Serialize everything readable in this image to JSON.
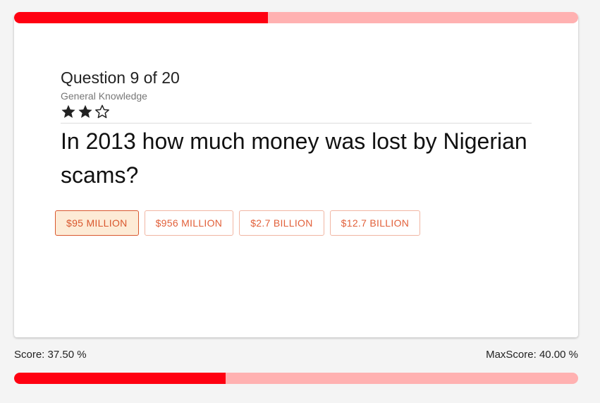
{
  "progress": {
    "question_fraction": 0.45,
    "score_fraction": 0.375
  },
  "question": {
    "counter": "Question 9 of 20",
    "category": "General Knowledge",
    "difficulty_stars": 2,
    "max_stars": 3,
    "text": "In 2013 how much money was lost by Nigerian scams?"
  },
  "answers": [
    {
      "label": "$95 MILLION",
      "selected": true
    },
    {
      "label": "$956 MILLION",
      "selected": false
    },
    {
      "label": "$2.7 BILLION",
      "selected": false
    },
    {
      "label": "$12.7 BILLION",
      "selected": false
    }
  ],
  "footer": {
    "score_label": "Score: 37.50 %",
    "max_score_label": "MaxScore: 40.00 %"
  },
  "colors": {
    "progress_fill": "#ff0011",
    "progress_track": "#ffb1b1",
    "answer_accent": "#e2603a"
  }
}
